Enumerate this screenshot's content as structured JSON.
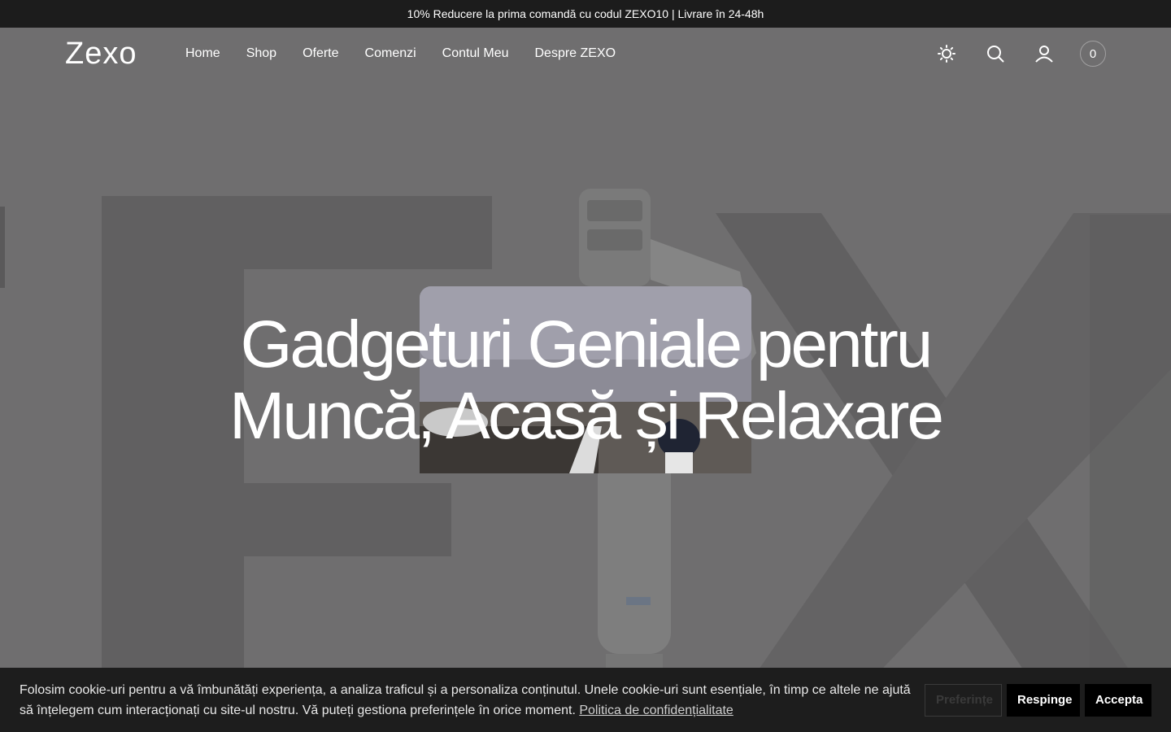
{
  "announcement": {
    "text": "10% Reducere la prima comandă cu codul ZEXO10 | Livrare în 24-48h"
  },
  "header": {
    "logo": "Zexo",
    "nav": [
      "Home",
      "Shop",
      "Oferte",
      "Comenzi",
      "Contul Meu",
      "Despre ZEXO"
    ],
    "icons": [
      "sun-icon",
      "search-icon",
      "user-icon"
    ],
    "cart_count": "0"
  },
  "hero": {
    "title_line1": "Gadgeturi Geniale pentru",
    "title_line2": "Muncă, Acasă și Relaxare"
  },
  "cookie": {
    "text": "Folosim cookie-uri pentru a vă îmbunătăți experiența, a analiza traficul și a personaliza conținutul. Unele cookie-uri sunt esențiale, în timp ce altele ne ajută să înțelegem cum interacționați cu site-ul nostru. Vă puteți gestiona preferințele în orice moment.",
    "link": "Politica de confidențialitate",
    "btn_preferences": "Preferințe",
    "btn_reject": "Respinge",
    "btn_accept": "Accepta"
  },
  "colors": {
    "announcement_bg": "#1c1c1c",
    "hero_overlay": "#6f6e6f",
    "cookie_bg": "#1d1d1d"
  }
}
